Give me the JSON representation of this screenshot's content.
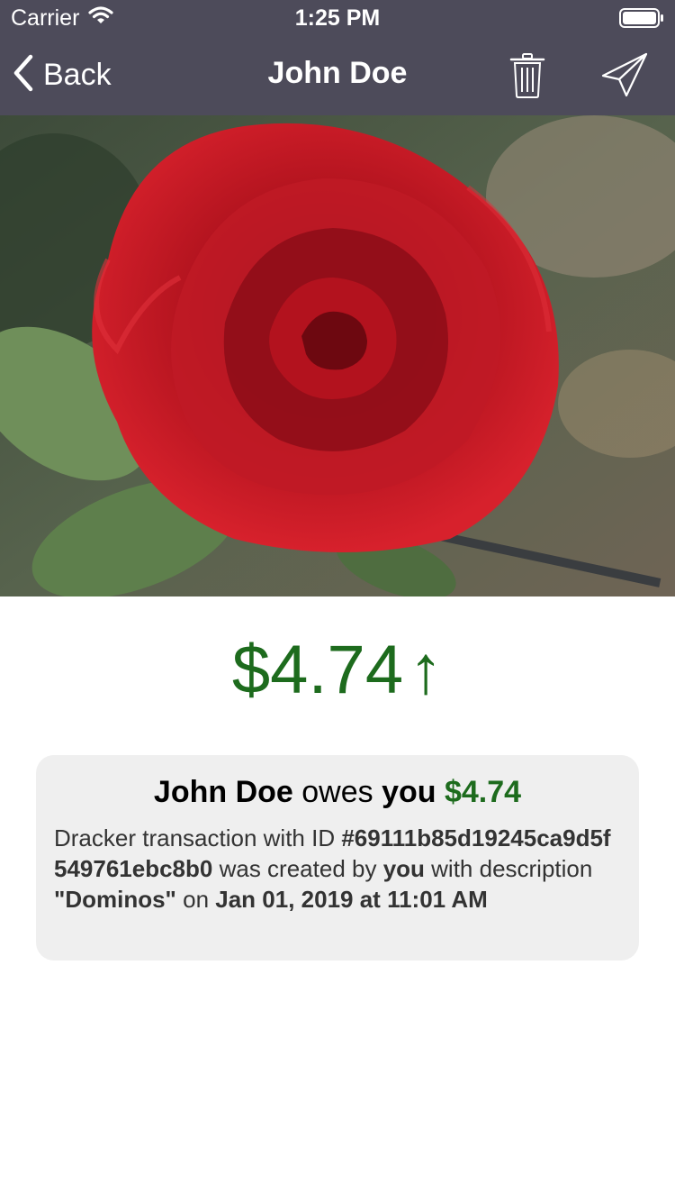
{
  "status_bar": {
    "carrier": "Carrier",
    "time": "1:25 PM"
  },
  "nav": {
    "back_label": "Back",
    "title": "John Doe",
    "icons": [
      "chevron-left-icon",
      "trash-icon",
      "send-icon"
    ]
  },
  "amount": {
    "value": "$4.74",
    "arrow": "↑",
    "color": "#1d6b1d"
  },
  "card": {
    "title_name": "John Doe",
    "title_owes": " owes ",
    "title_you": "you",
    "title_amount": "$4.74",
    "body_prefix": "Dracker transaction with ID ",
    "transaction_id": "#69111b85d19245ca9d5f549761ebc8b0",
    "created_by_text": " was created by ",
    "created_by": "you",
    "description_text": " with description ",
    "description": "\"Dominos\"",
    "on_text": " on ",
    "datetime": "Jan 01, 2019 at 11:01 AM"
  },
  "colors": {
    "nav_background": "#4d4b5a",
    "card_background": "#efefef",
    "accent_green": "#1d6b1d"
  }
}
